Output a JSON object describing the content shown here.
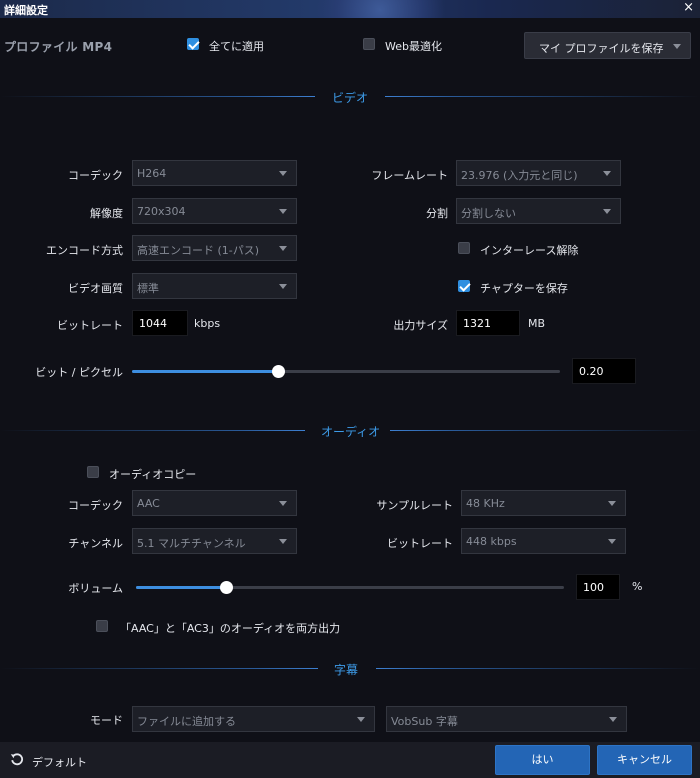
{
  "window": {
    "title": "詳細設定",
    "close_icon": "×"
  },
  "header": {
    "profile_label": "プロファイル MP4",
    "apply_all": {
      "label": "全てに適用",
      "checked": true
    },
    "web_optimize": {
      "label": "Web最適化",
      "checked": false
    },
    "save_profile_label": "マイ プロファイルを保存"
  },
  "video": {
    "section_title": "ビデオ",
    "codec": {
      "label": "コーデック",
      "value": "H264"
    },
    "resolution": {
      "label": "解像度",
      "value": "720x304"
    },
    "encode_method": {
      "label": "エンコード方式",
      "value": "高速エンコード (1-パス)"
    },
    "quality": {
      "label": "ビデオ画質",
      "value": "標準"
    },
    "bitrate": {
      "label": "ビットレート",
      "value": "1044",
      "unit": "kbps"
    },
    "framerate": {
      "label": "フレームレート",
      "value": "23.976 (入力元と同じ)"
    },
    "split": {
      "label": "分割",
      "value": "分割しない"
    },
    "deinterlace": {
      "label": "インターレース解除",
      "checked": false
    },
    "keep_chapters": {
      "label": "チャプターを保存",
      "checked": true
    },
    "output_size": {
      "label": "出力サイズ",
      "value": "1321",
      "unit": "MB"
    },
    "bits_per_pixel": {
      "label": "ビット / ピクセル",
      "value": "0.20",
      "fraction": 0.34
    }
  },
  "audio": {
    "section_title": "オーディオ",
    "audio_copy": {
      "label": "オーディオコピー",
      "checked": false
    },
    "codec": {
      "label": "コーデック",
      "value": "AAC"
    },
    "channels": {
      "label": "チャンネル",
      "value": "5.1 マルチチャンネル"
    },
    "samplerate": {
      "label": "サンプルレート",
      "value": "48 KHz"
    },
    "bitrate": {
      "label": "ビットレート",
      "value": "448 kbps"
    },
    "volume": {
      "label": "ボリューム",
      "value": "100",
      "unit": "%",
      "fraction": 0.21
    },
    "dual_output": {
      "label": "「AAC」と「AC3」のオーディオを両方出力",
      "checked": false
    }
  },
  "subtitles": {
    "section_title": "字幕",
    "mode": {
      "label": "モード",
      "value": "ファイルに追加する"
    },
    "format": {
      "value": "VobSub 字幕"
    }
  },
  "footer": {
    "default_label": "デフォルト",
    "ok_label": "はい",
    "cancel_label": "キャンセル"
  },
  "colors": {
    "accent": "#3d8ee0",
    "section_title": "#3d9be8",
    "primary_button": "#2365b5",
    "background": "#0f1017"
  }
}
